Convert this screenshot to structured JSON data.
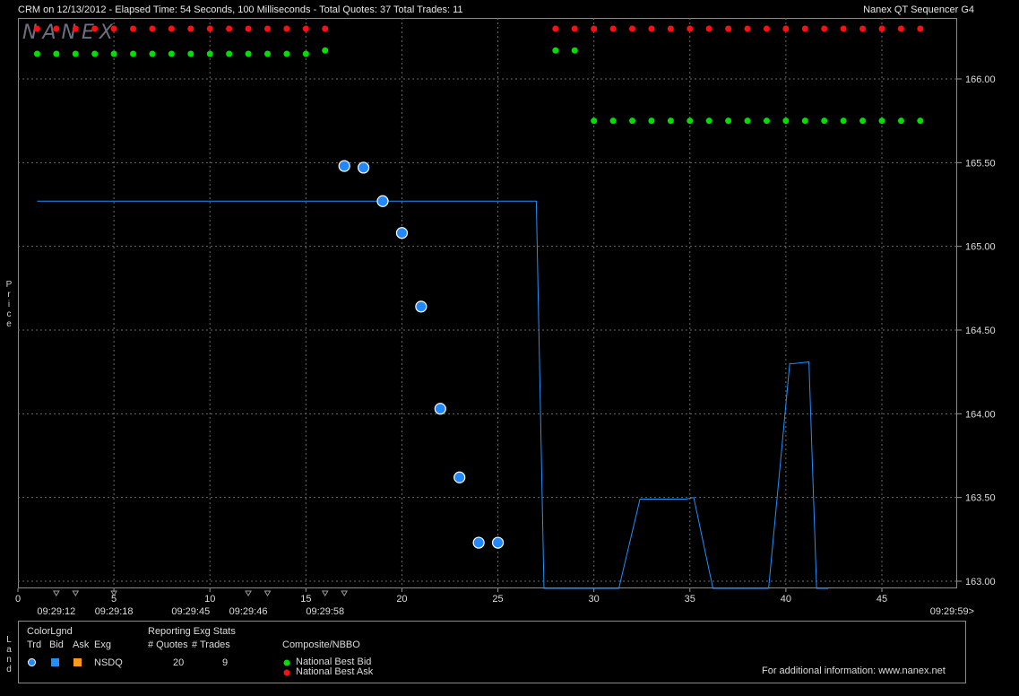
{
  "header": {
    "title": "CRM on 12/13/2012  -  Elapsed Time: 54 Seconds, 100 Milliseconds  -  Total Quotes: 37  Total Trades: 11",
    "app_name": "Nanex QT Sequencer G4",
    "logo_text": "NANEX"
  },
  "y_axis_label_chars": [
    "P",
    "r",
    "i",
    "c",
    "e"
  ],
  "legend": {
    "side_label_chars": [
      "L",
      "a",
      "n",
      "d"
    ],
    "color_legend_title": "ColorLgnd",
    "col_trd": "Trd",
    "col_bid": "Bid",
    "col_ask": "Ask",
    "col_exg": "Exg",
    "exchange": "NSDQ",
    "stats_title": "Reporting Exg Stats",
    "col_quotes": "# Quotes",
    "col_trades": "# Trades",
    "quotes_count": "20",
    "trades_count": "9",
    "nbbo_title": "Composite/NBBO",
    "best_bid_label": "National Best Bid",
    "best_ask_label": "National Best Ask",
    "footer_info": "For additional information: www.nanex.net",
    "colors": {
      "trade": "#2288ff",
      "bid": "#1e90ff",
      "ask": "#ff9a1a",
      "best_bid": "#00e000",
      "best_ask": "#ff1010"
    }
  },
  "chart_data": {
    "type": "scatter",
    "xlim": [
      0,
      48.5
    ],
    "ylim": [
      162.95,
      166.3
    ],
    "x_ticks": [
      0,
      5,
      10,
      15,
      20,
      25,
      30,
      35,
      40,
      45
    ],
    "x_tick_labels": [
      "0",
      "5",
      "10",
      "15",
      "20",
      "25",
      "30",
      "35",
      "40",
      "45"
    ],
    "y_ticks": [
      163.0,
      163.5,
      164.0,
      164.5,
      165.0,
      165.5,
      166.0
    ],
    "y_tick_labels": [
      "163.00",
      "163.50",
      "164.00",
      "164.50",
      "165.00",
      "165.50",
      "166.00"
    ],
    "grid": true,
    "time_labels": [
      {
        "x": 2,
        "label": "09:29:12"
      },
      {
        "x": 5,
        "label": "09:29:18"
      },
      {
        "x": 9,
        "label": "09:29:45"
      },
      {
        "x": 12,
        "label": "09:29:46"
      },
      {
        "x": 16,
        "label": "09:29:58"
      },
      {
        "x": 48.5,
        "label": "09:29:59>"
      }
    ],
    "time_markers": [
      2,
      3,
      5,
      12,
      13,
      16,
      17
    ],
    "series": [
      {
        "name": "Trd",
        "type": "scatter",
        "x": [
          17,
          18,
          19,
          20,
          21,
          22,
          23,
          24,
          25
        ],
        "y": [
          165.48,
          165.47,
          165.27,
          165.08,
          164.64,
          164.03,
          163.62,
          163.23,
          163.23
        ]
      },
      {
        "name": "Bid",
        "type": "line",
        "x": [
          1,
          27,
          27.4,
          28.2,
          29.0,
          29.3,
          31.3,
          32.4,
          34.8,
          35.2,
          36.2,
          38.5,
          39.1,
          40.2,
          40.4,
          41.2,
          41.6,
          42.2
        ],
        "y": [
          165.27,
          165.27,
          162.95,
          162.95,
          162.95,
          162.95,
          162.95,
          163.49,
          163.49,
          163.5,
          162.95,
          162.95,
          162.95,
          164.3,
          164.3,
          164.31,
          162.95,
          162.95
        ]
      },
      {
        "name": "National Best Bid",
        "type": "scatter",
        "x": [
          1,
          2,
          3,
          4,
          5,
          6,
          7,
          8,
          9,
          10,
          11,
          12,
          13,
          14,
          15,
          16,
          28,
          29,
          30,
          31,
          32,
          33,
          34,
          35,
          36,
          37,
          38,
          39,
          40,
          41,
          42,
          43,
          44,
          45,
          46,
          47
        ],
        "y": [
          166.15,
          166.15,
          166.15,
          166.15,
          166.15,
          166.15,
          166.15,
          166.15,
          166.15,
          166.15,
          166.15,
          166.15,
          166.15,
          166.15,
          166.15,
          166.17,
          166.17,
          166.17,
          165.75,
          165.75,
          165.75,
          165.75,
          165.75,
          165.75,
          165.75,
          165.75,
          165.75,
          165.75,
          165.75,
          165.75,
          165.75,
          165.75,
          165.75,
          165.75,
          165.75,
          165.75
        ]
      },
      {
        "name": "National Best Ask",
        "type": "scatter",
        "x": [
          1,
          2,
          3,
          4,
          5,
          6,
          7,
          8,
          9,
          10,
          11,
          12,
          13,
          14,
          15,
          16,
          28,
          29,
          30,
          31,
          32,
          33,
          34,
          35,
          36,
          37,
          38,
          39,
          40,
          41,
          42,
          43,
          44,
          45,
          46,
          47
        ],
        "y": [
          166.3,
          166.3,
          166.3,
          166.3,
          166.3,
          166.3,
          166.3,
          166.3,
          166.3,
          166.3,
          166.3,
          166.3,
          166.3,
          166.3,
          166.3,
          166.3,
          166.3,
          166.3,
          166.3,
          166.3,
          166.3,
          166.3,
          166.3,
          166.3,
          166.3,
          166.3,
          166.3,
          166.3,
          166.3,
          166.3,
          166.3,
          166.3,
          166.3,
          166.3,
          166.3,
          166.3
        ]
      }
    ]
  }
}
